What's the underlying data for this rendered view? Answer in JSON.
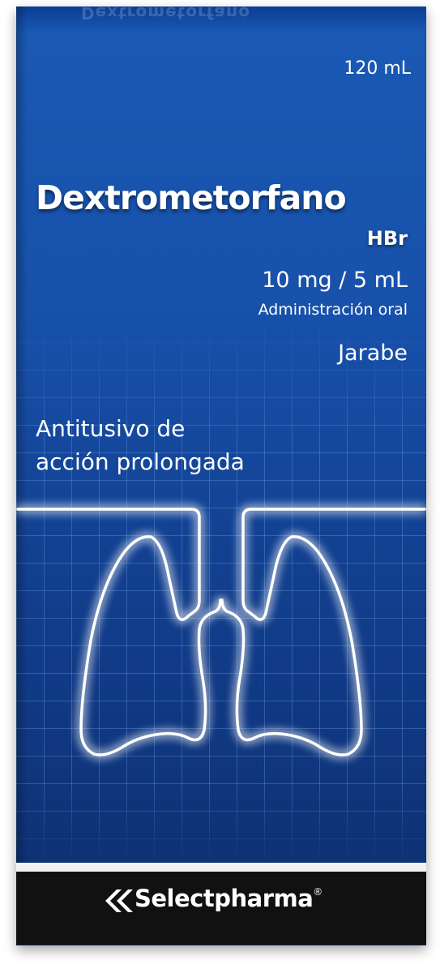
{
  "package": {
    "volume": "120 mL",
    "product_name": "Dextrometorfano",
    "salt": "HBr",
    "concentration": "10 mg / 5 mL",
    "route": "Administración oral",
    "dosage_form": "Jarabe",
    "claim_line1": "Antitusivo de",
    "claim_line2": "acción prolongada",
    "brand": "Selectpharma",
    "registered_mark": "®"
  },
  "colors": {
    "background": "#1750a9",
    "lung_glow": "#7fd4ff",
    "footer": "#111111"
  },
  "icons": [
    "lungs-icon",
    "selectpharma-logo-icon"
  ]
}
